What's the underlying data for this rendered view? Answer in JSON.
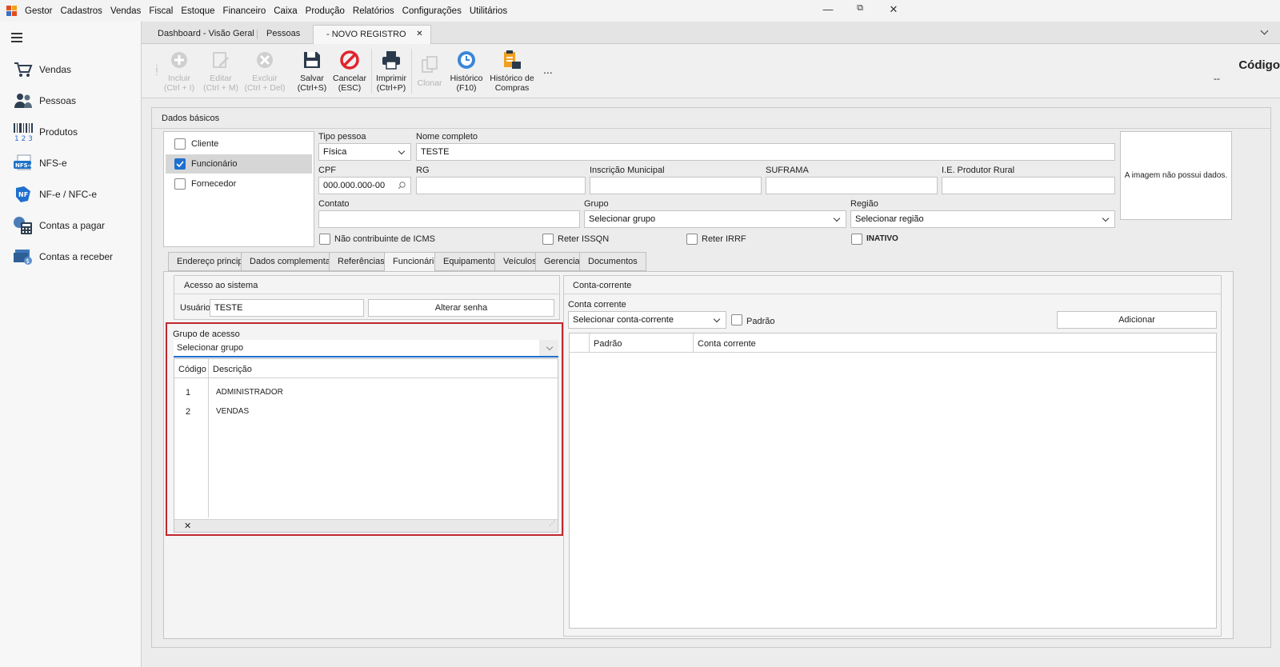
{
  "menubar": {
    "items": [
      "Gestor",
      "Cadastros",
      "Vendas",
      "Fiscal",
      "Estoque",
      "Financeiro",
      "Caixa",
      "Produção",
      "Relatórios",
      "Configurações",
      "Utilitários"
    ],
    "min": "—",
    "restore": "⧉",
    "close": "✕"
  },
  "sidebar": {
    "items": [
      {
        "label": "Vendas",
        "icon": "cart-icon"
      },
      {
        "label": "Pessoas",
        "icon": "people-icon"
      },
      {
        "label": "Produtos",
        "icon": "barcode-icon"
      },
      {
        "label": "NFS-e",
        "icon": "nfse-icon"
      },
      {
        "label": "NF-e / NFC-e",
        "icon": "nfe-icon"
      },
      {
        "label": "Contas a pagar",
        "icon": "calculator-icon"
      },
      {
        "label": "Contas a receber",
        "icon": "money-icon"
      }
    ]
  },
  "doc_tabs": [
    "Dashboard - Visão Geral",
    "Pessoas",
    "- NOVO REGISTRO"
  ],
  "doc_tab_close": "✕",
  "toolbar": {
    "buttons": [
      {
        "label": "Incluir",
        "sub": "(Ctrl + I)"
      },
      {
        "label": "Editar",
        "sub": "(Ctrl + M)"
      },
      {
        "label": "Excluir",
        "sub": "(Ctrl + Del)"
      },
      {
        "label": "Salvar",
        "sub": "(Ctrl+S)"
      },
      {
        "label": "Cancelar",
        "sub": "(ESC)"
      },
      {
        "label": "Imprimir",
        "sub": "(Ctrl+P)"
      },
      {
        "label": "Clonar",
        "sub": ""
      },
      {
        "label": "Histórico",
        "sub": "(F10)"
      },
      {
        "label": "Histórico de",
        "sub": "Compras"
      }
    ],
    "more": "...",
    "codigo_label": "Código",
    "codigo_value": "--"
  },
  "dados_basicos": {
    "title": "Dados básicos",
    "roles": [
      {
        "label": "Cliente",
        "checked": false
      },
      {
        "label": "Funcionário",
        "checked": true
      },
      {
        "label": "Fornecedor",
        "checked": false
      }
    ],
    "tipo_pessoa_label": "Tipo pessoa",
    "tipo_pessoa_value": "Física",
    "nome_label": "Nome completo",
    "nome_value": "TESTE",
    "cpf_label": "CPF",
    "cpf_value": "000.000.000-00",
    "rg_label": "RG",
    "im_label": "Inscrição Municipal",
    "suframa_label": "SUFRAMA",
    "ie_label": "I.E. Produtor Rural",
    "contato_label": "Contato",
    "grupo_label": "Grupo",
    "grupo_value": "Selecionar grupo",
    "regiao_label": "Região",
    "regiao_value": "Selecionar região",
    "nao_contribuinte": "Não contribuinte de ICMS",
    "reter_issqn": "Reter ISSQN",
    "reter_irrf": "Reter IRRF",
    "inativo": "INATIVO",
    "image_text": "A imagem não possui dados."
  },
  "sub_tabs": [
    "Endereço principal",
    "Dados complementares",
    "Referências",
    "Funcionário",
    "Equipamentos",
    "Veículos",
    "Gerencial",
    "Documentos"
  ],
  "acesso": {
    "title": "Acesso ao sistema",
    "usuario_label": "Usuário:",
    "usuario_value": "TESTE",
    "alterar_senha": "Alterar senha"
  },
  "grupo_acesso": {
    "label": "Grupo de acesso",
    "placeholder": "Selecionar grupo",
    "columns": [
      "Código",
      "Descrição"
    ],
    "rows": [
      {
        "codigo": "1",
        "descricao": "ADMINISTRADOR"
      },
      {
        "codigo": "2",
        "descricao": "VENDAS"
      }
    ],
    "clear": "✕"
  },
  "conta_corrente": {
    "title": "Conta-corrente",
    "label": "Conta corrente",
    "select_value": "Selecionar conta-corrente",
    "padrao": "Padrão",
    "adicionar": "Adicionar",
    "columns": [
      "Padrão",
      "Conta corrente"
    ]
  },
  "colors": {
    "highlight": "#c0272d",
    "accent": "#1e6fd0"
  }
}
